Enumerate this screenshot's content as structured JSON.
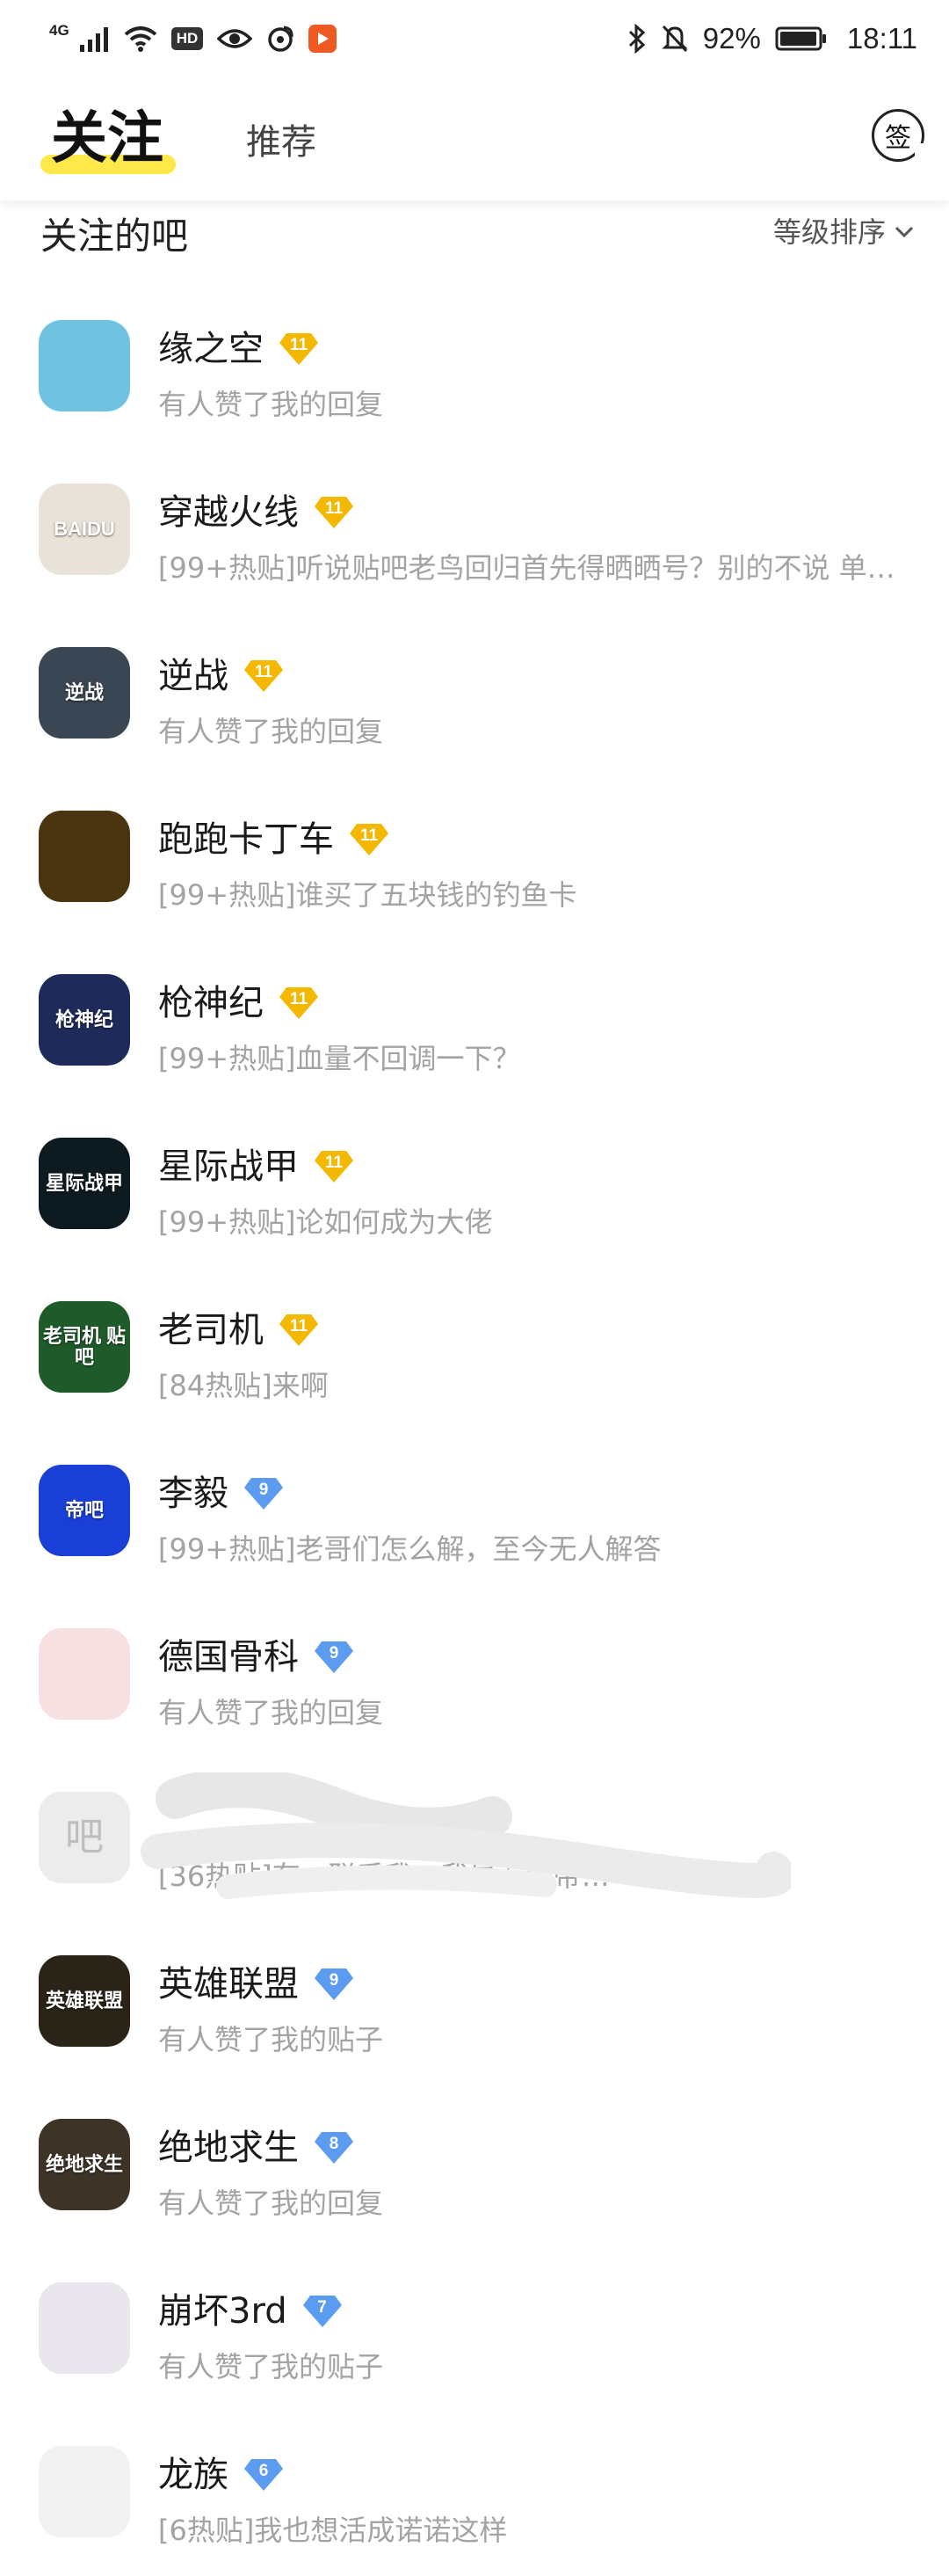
{
  "status_bar": {
    "network": "4G",
    "hd": "HD",
    "battery": "92%",
    "time": "18:11"
  },
  "header": {
    "tab_following": "关注",
    "tab_recommend": "推荐",
    "sign_label": "签"
  },
  "section": {
    "title": "关注的吧",
    "sort_label": "等级排序"
  },
  "forums": [
    {
      "name": "缘之空",
      "level": "11",
      "desc": "有人赞了我的回复",
      "badge_color": "#f5b800",
      "avatar_bg": "#6fc3e0",
      "avatar_text": ""
    },
    {
      "name": "穿越火线",
      "level": "11",
      "desc": "[99+热贴]听说贴吧老鸟回归首先得晒晒号？别的不说 单…",
      "badge_color": "#f5b800",
      "avatar_bg": "#e8e2d8",
      "avatar_text": "BAIDU"
    },
    {
      "name": "逆战",
      "level": "11",
      "desc": "有人赞了我的回复",
      "badge_color": "#f5b800",
      "avatar_bg": "#3b4654",
      "avatar_text": "逆战"
    },
    {
      "name": "跑跑卡丁车",
      "level": "11",
      "desc": "[99+热贴]谁买了五块钱的钓鱼卡",
      "badge_color": "#f5b800",
      "avatar_bg": "#4a3510",
      "avatar_text": ""
    },
    {
      "name": "枪神纪",
      "level": "11",
      "desc": "[99+热贴]血量不回调一下？",
      "badge_color": "#f5b800",
      "avatar_bg": "#1e2a5a",
      "avatar_text": "枪神纪"
    },
    {
      "name": "星际战甲",
      "level": "11",
      "desc": "[99+热贴]论如何成为大佬",
      "badge_color": "#f5b800",
      "avatar_bg": "#0d1a1f",
      "avatar_text": "星际战甲"
    },
    {
      "name": "老司机",
      "level": "11",
      "desc": "[84热贴]来啊",
      "badge_color": "#f5b800",
      "avatar_bg": "#1f5a2a",
      "avatar_text": "老司机 贴吧"
    },
    {
      "name": "李毅",
      "level": "9",
      "desc": "[99+热贴]老哥们怎么解，至今无人解答",
      "badge_color": "#5b9bf0",
      "avatar_bg": "#1a3fd6",
      "avatar_text": "帝吧"
    },
    {
      "name": "德国骨科",
      "level": "9",
      "desc": "有人赞了我的回复",
      "badge_color": "#5b9bf0",
      "avatar_bg": "#f6e0e2",
      "avatar_text": ""
    },
    {
      "name": "",
      "level": "",
      "desc": "[36热贴]有…联系我，我是专门带…",
      "badge_color": "#5b9bf0",
      "avatar_bg": "#ececec",
      "avatar_text": "吧",
      "redacted": true
    },
    {
      "name": "英雄联盟",
      "level": "9",
      "desc": "有人赞了我的贴子",
      "badge_color": "#5b9bf0",
      "avatar_bg": "#2a2418",
      "avatar_text": "英雄联盟"
    },
    {
      "name": "绝地求生",
      "level": "8",
      "desc": "有人赞了我的回复",
      "badge_color": "#5b9bf0",
      "avatar_bg": "#3d3326",
      "avatar_text": "绝地求生"
    },
    {
      "name": "崩坏3rd",
      "level": "7",
      "desc": "有人赞了我的贴子",
      "badge_color": "#5b9bf0",
      "avatar_bg": "#e9e6ee",
      "avatar_text": ""
    },
    {
      "name": "龙族",
      "level": "6",
      "desc": "[6热贴]我也想活成诺诺这样",
      "badge_color": "#5b9bf0",
      "avatar_bg": "#f2f2f2",
      "avatar_text": ""
    }
  ]
}
